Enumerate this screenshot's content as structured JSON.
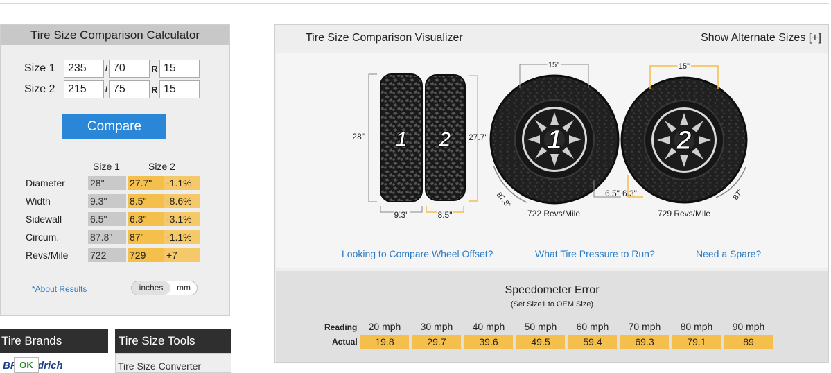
{
  "calculator": {
    "title": "Tire Size Comparison Calculator",
    "size1": {
      "label": "Size 1",
      "width": "235",
      "aspect": "70",
      "rim": "15"
    },
    "size2": {
      "label": "Size 2",
      "width": "215",
      "aspect": "75",
      "rim": "15"
    },
    "slash": "/",
    "rim_prefix": "R",
    "compare_label": "Compare",
    "results": {
      "col1": "Size 1",
      "col2": "Size 2",
      "rows": [
        {
          "label": "Diameter",
          "s1": "28\"",
          "s2": "27.7\"",
          "diff": "-1.1%"
        },
        {
          "label": "Width",
          "s1": "9.3\"",
          "s2": "8.5\"",
          "diff": "-8.6%"
        },
        {
          "label": "Sidewall",
          "s1": "6.5\"",
          "s2": "6.3\"",
          "diff": "-3.1%"
        },
        {
          "label": "Circum.",
          "s1": "87.8\"",
          "s2": "87\"",
          "diff": "-1.1%"
        },
        {
          "label": "Revs/Mile",
          "s1": "722",
          "s2": "729",
          "diff": "+7"
        }
      ]
    },
    "about_link": "*About Results",
    "units": {
      "selected": "inches",
      "other": "mm"
    }
  },
  "tabs": {
    "brands": "Tire Brands",
    "tools": "Tire Size Tools",
    "tools_first_item": "Tire Size Converter",
    "brand_logo_text": "BFGoodrich",
    "ok_badge": "OK"
  },
  "visualizer": {
    "title": "Tire Size Comparison Visualizer",
    "alt_link": "Show Alternate Sizes [+]",
    "tread": {
      "num1": "1",
      "num2": "2",
      "height1": "28\"",
      "height2": "27.7\"",
      "width1": "9.3\"",
      "width2": "8.5\""
    },
    "wheel1": {
      "num": "1",
      "rim": "15\"",
      "sidewall": "6.5\"",
      "circ": "87.8\"",
      "revs": "722 Revs/Mile"
    },
    "wheel2": {
      "num": "2",
      "rim": "15\"",
      "sidewall": "6.3\"",
      "circ": "87\"",
      "revs": "729 Revs/Mile"
    },
    "links": [
      "Looking to Compare Wheel Offset?",
      "What Tire Pressure to Run?",
      "Need a Spare?"
    ]
  },
  "speedometer": {
    "title": "Speedometer Error",
    "subtitle": "(Set Size1 to OEM Size)",
    "reading_label": "Reading",
    "actual_label": "Actual",
    "readings": [
      "20 mph",
      "30 mph",
      "40 mph",
      "50 mph",
      "60 mph",
      "70 mph",
      "80 mph",
      "90 mph"
    ],
    "actuals": [
      "19.8",
      "29.7",
      "39.6",
      "49.5",
      "59.4",
      "69.3",
      "79.1",
      "89"
    ]
  }
}
